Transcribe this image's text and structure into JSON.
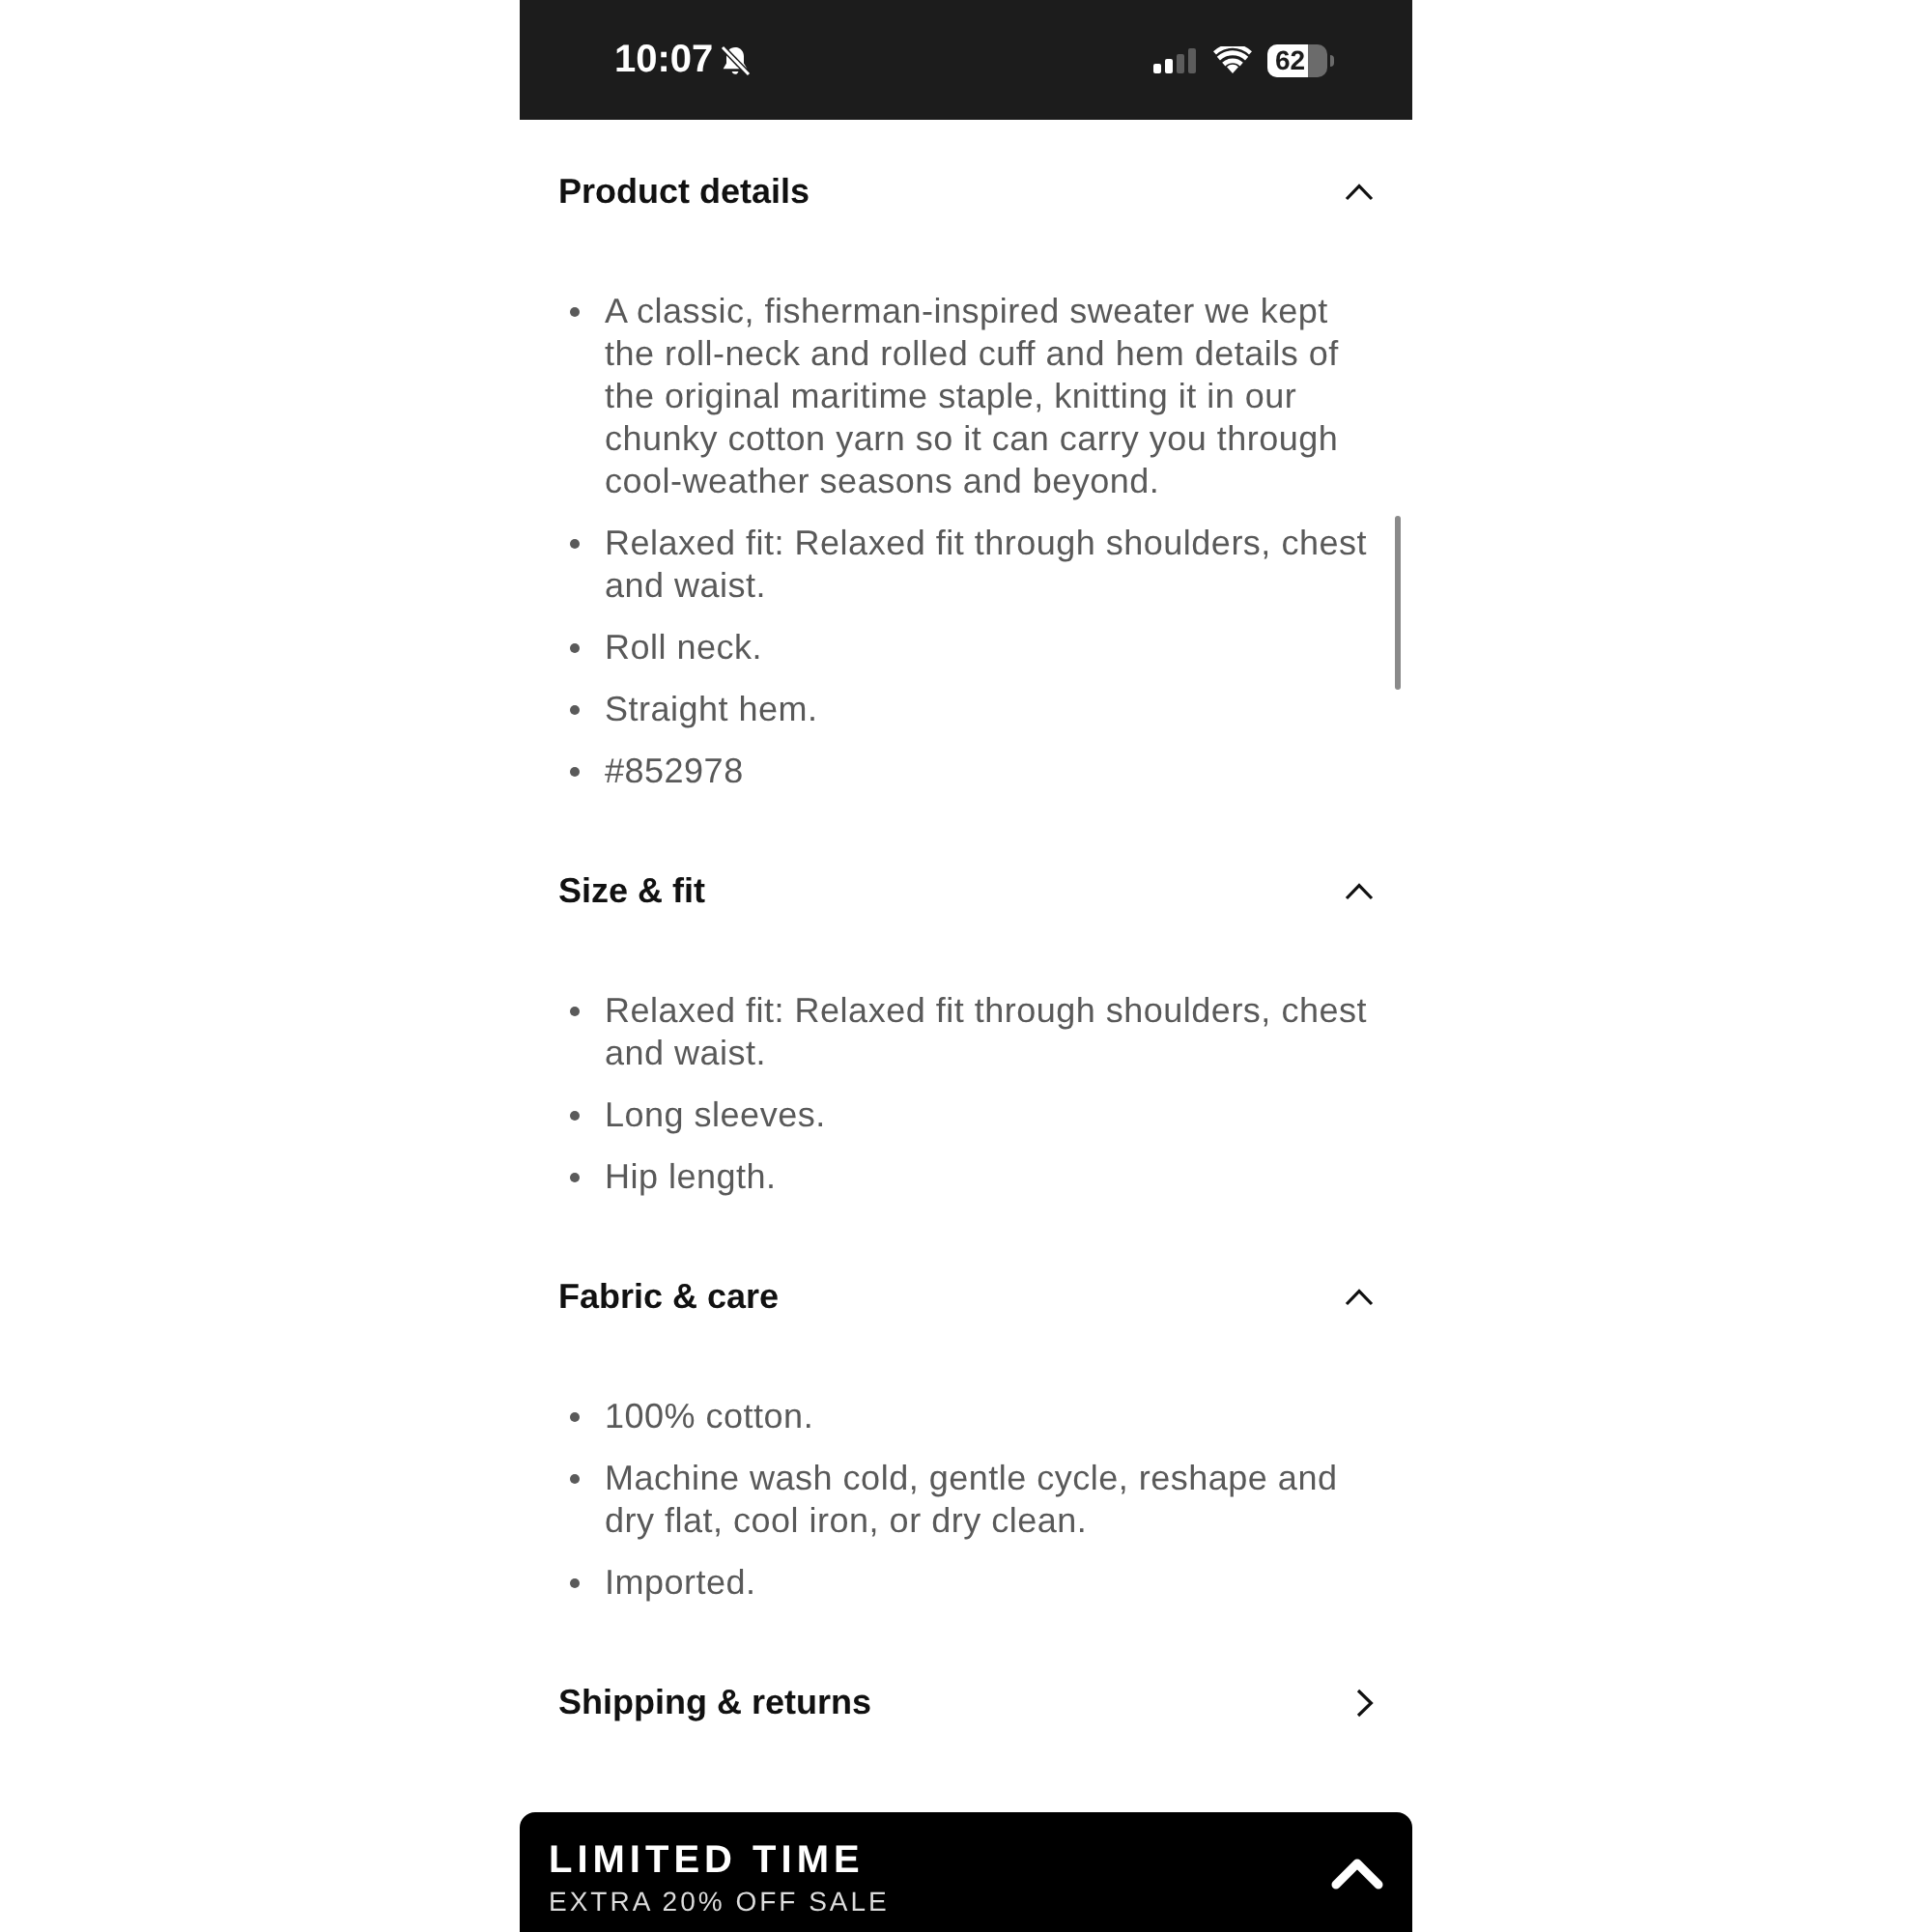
{
  "status_bar": {
    "time": "10:07",
    "silent": true,
    "battery": "62"
  },
  "sections": [
    {
      "title": "Product details",
      "expanded": true,
      "items": [
        "A classic, fisherman-inspired sweater we kept the roll-neck and rolled cuff and hem details of the original maritime staple, knitting it in our chunky cotton yarn so it can carry you through cool-weather seasons and beyond.",
        "Relaxed fit: Relaxed fit through shoulders, chest and waist.",
        "Roll neck.",
        "Straight hem.",
        "#852978"
      ]
    },
    {
      "title": "Size & fit",
      "expanded": true,
      "items": [
        "Relaxed fit: Relaxed fit through shoulders, chest and waist.",
        "Long sleeves.",
        "Hip length."
      ]
    },
    {
      "title": "Fabric & care",
      "expanded": true,
      "items": [
        "100% cotton.",
        "Machine wash cold, gentle cycle, reshape and dry flat, cool iron, or dry clean.",
        "Imported."
      ]
    },
    {
      "title": "Shipping & returns",
      "expanded": false
    }
  ],
  "promo_banner": {
    "title": "LIMITED TIME",
    "subtitle": "EXTRA 20% OFF SALE"
  }
}
